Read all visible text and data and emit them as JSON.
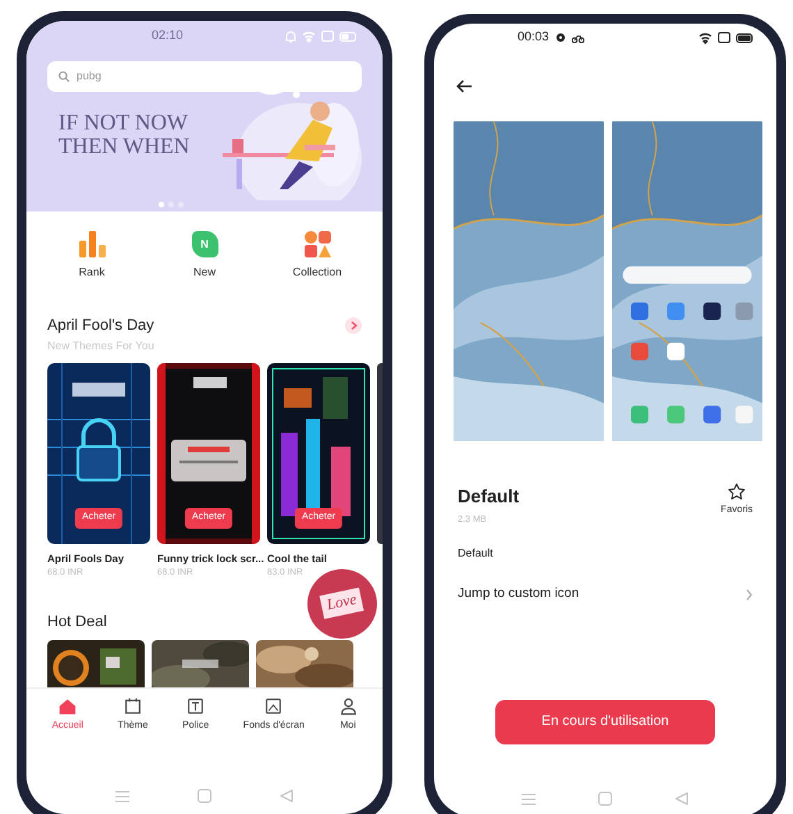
{
  "left_phone": {
    "status_bar": {
      "time": "02:10"
    },
    "search": {
      "value": "pubg"
    },
    "banner": {
      "headline_lines": [
        "IF NOT NOW",
        "THEN WHEN"
      ],
      "dots": [
        {
          "selected": true
        },
        {
          "selected": false
        },
        {
          "selected": false
        }
      ]
    },
    "shortcuts": [
      {
        "label": "Rank",
        "kind": "rank"
      },
      {
        "label": "New",
        "kind": "new",
        "icon_text": "N"
      },
      {
        "label": "Collection",
        "kind": "collection"
      }
    ],
    "section": {
      "title": "April Fool's Day",
      "subtitle": "New Themes For You",
      "themes": [
        {
          "name": "April Fools Day",
          "price": "68.0 INR",
          "button": "Acheter"
        },
        {
          "name": "Funny trick lock scr...",
          "price": "68.0 INR",
          "button": "Acheter"
        },
        {
          "name": "Cool the tail",
          "price": "83.0 INR",
          "button": "Acheter"
        }
      ]
    },
    "hot_deal": {
      "title": "Hot Deal",
      "sticker": "Love"
    },
    "nav": [
      {
        "label": "Accueil",
        "kind": "home",
        "selected": true
      },
      {
        "label": "Thème",
        "kind": "theme",
        "selected": false
      },
      {
        "label": "Police",
        "kind": "font",
        "selected": false
      },
      {
        "label": "Fonds d'écran",
        "kind": "wallpaper",
        "selected": false
      },
      {
        "label": "Moi",
        "kind": "me",
        "selected": false
      }
    ]
  },
  "right_phone": {
    "status_bar": {
      "time": "00:03"
    },
    "title": "Default",
    "size": "2.3 MB",
    "favorite": {
      "label": "Favoris",
      "on": false
    },
    "description": "Default",
    "link": "Jump to custom icon",
    "button": "En cours d'utilisation"
  }
}
